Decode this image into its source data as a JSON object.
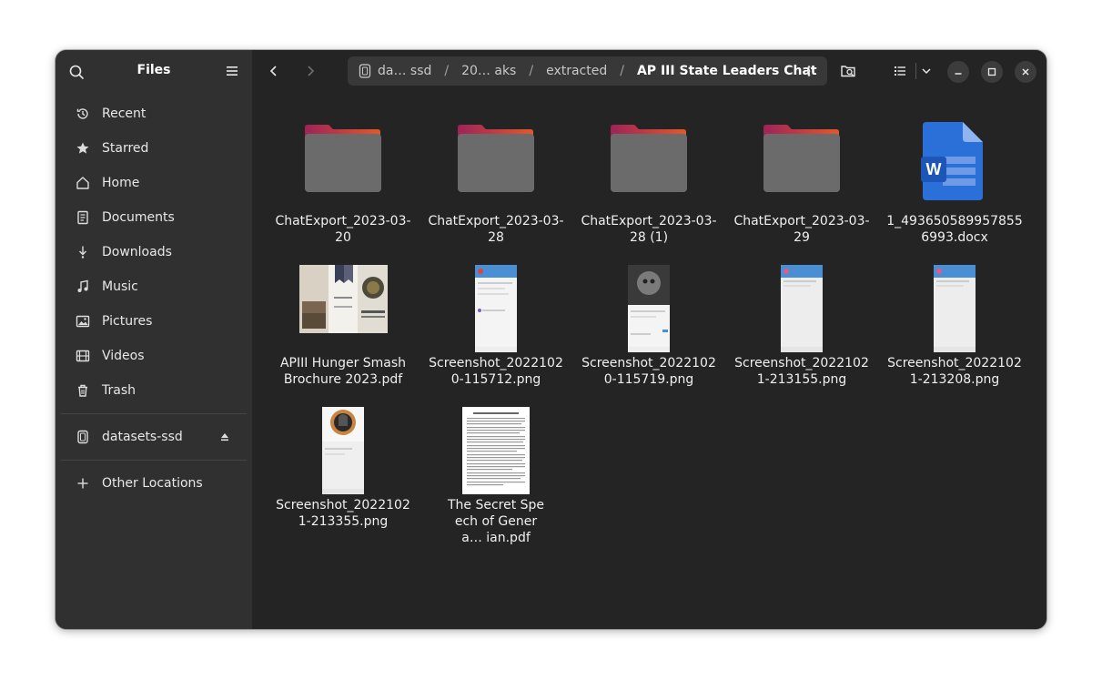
{
  "sidebar": {
    "title": "Files",
    "places": [
      {
        "label": "Recent",
        "icon": "clock-icon"
      },
      {
        "label": "Starred",
        "icon": "star-icon"
      },
      {
        "label": "Home",
        "icon": "home-icon"
      },
      {
        "label": "Documents",
        "icon": "document-icon"
      },
      {
        "label": "Downloads",
        "icon": "download-icon"
      },
      {
        "label": "Music",
        "icon": "music-icon"
      },
      {
        "label": "Pictures",
        "icon": "pictures-icon"
      },
      {
        "label": "Videos",
        "icon": "film-icon"
      },
      {
        "label": "Trash",
        "icon": "trash-icon"
      }
    ],
    "devices": [
      {
        "label": "datasets-ssd",
        "icon": "drive-icon"
      }
    ],
    "other": {
      "label": "Other Locations",
      "icon": "plus-icon"
    }
  },
  "path": {
    "crumbs": [
      "da… ssd",
      "20… aks",
      "extracted"
    ],
    "current": "AP III State Leaders Chat",
    "separator": "/"
  },
  "files": [
    {
      "name": "ChatExport_2023-03-20",
      "type": "folder"
    },
    {
      "name": "ChatExport_2023-03-28",
      "type": "folder"
    },
    {
      "name": "ChatExport_2023-03-28 (1)",
      "type": "folder"
    },
    {
      "name": "ChatExport_2023-03-29",
      "type": "folder"
    },
    {
      "name": "1_4936505899578556993.docx",
      "type": "docx"
    },
    {
      "name": "APIII Hunger Smash Brochure 2023.pdf",
      "type": "brochure"
    },
    {
      "name": "Screenshot_20221020-115712.png",
      "type": "phone"
    },
    {
      "name": "Screenshot_20221020-115719.png",
      "type": "phone-dark"
    },
    {
      "name": "Screenshot_20221021-213155.png",
      "type": "phone"
    },
    {
      "name": "Screenshot_20221021-213208.png",
      "type": "phone"
    },
    {
      "name": "Screenshot_20221021-213355.png",
      "type": "phone-logo"
    },
    {
      "name": "The Secret Speech of Genera… ian.pdf",
      "type": "textdoc"
    }
  ],
  "colors": {
    "folder_top": "#e0512f",
    "folder_top2": "#a3265a",
    "folder_body": "#6b6b6b",
    "word_blue": "#2b6fd9"
  }
}
